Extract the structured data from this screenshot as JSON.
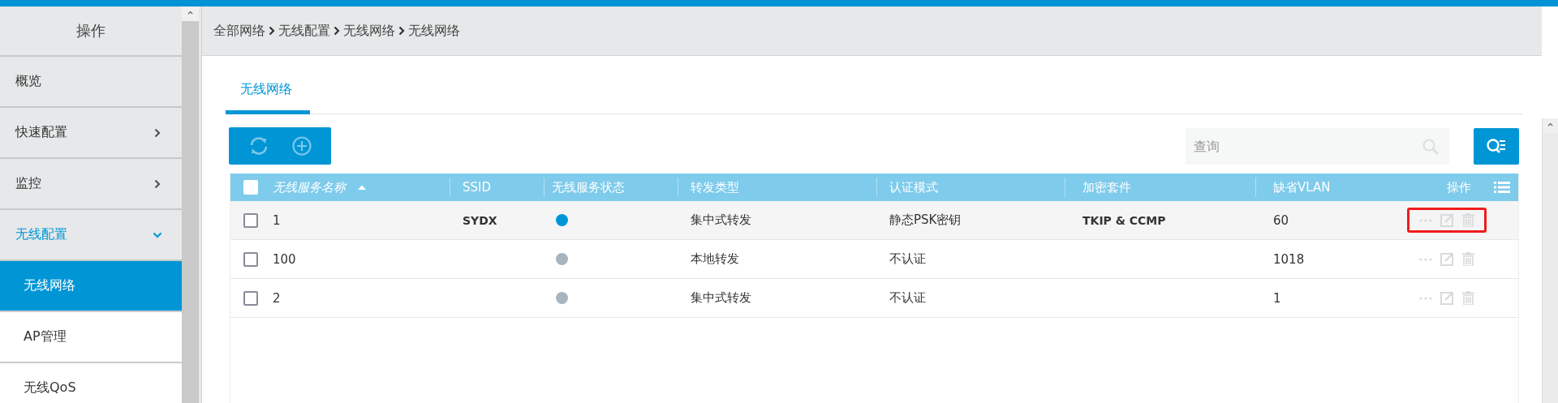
{
  "sidebar": {
    "title": "操作",
    "scroll_up": "⌃",
    "items": [
      {
        "label": "概览",
        "kind": "item",
        "expanded": false,
        "selected": false
      },
      {
        "label": "快速配置",
        "kind": "group",
        "expanded": false,
        "selected": false
      },
      {
        "label": "监控",
        "kind": "group",
        "expanded": false,
        "selected": false
      },
      {
        "label": "无线配置",
        "kind": "group",
        "expanded": true,
        "selected": false
      },
      {
        "label": "无线网络",
        "kind": "sub",
        "expanded": false,
        "selected": true
      },
      {
        "label": "AP管理",
        "kind": "sub",
        "expanded": false,
        "selected": false
      },
      {
        "label": "无线QoS",
        "kind": "sub",
        "expanded": false,
        "selected": false
      }
    ]
  },
  "breadcrumb": [
    "全部网络",
    "无线配置",
    "无线网络",
    "无线网络"
  ],
  "tabs": [
    {
      "label": "无线网络",
      "selected": true
    }
  ],
  "search": {
    "placeholder": "查询"
  },
  "table": {
    "all_checked": false,
    "columns": [
      {
        "label": "无线服务名称",
        "sorted": true
      },
      {
        "label": "SSID",
        "sorted": false
      },
      {
        "label": "无线服务状态",
        "sorted": false
      },
      {
        "label": "转发类型",
        "sorted": false
      },
      {
        "label": "认证模式",
        "sorted": false
      },
      {
        "label": "加密套件",
        "sorted": false
      },
      {
        "label": "缺省VLAN",
        "sorted": false
      },
      {
        "label": "操作",
        "sorted": false
      }
    ],
    "rows": [
      {
        "checked": false,
        "name": "1",
        "ssid": "SYDX",
        "active": true,
        "forwarding": "集中式转发",
        "auth": "静态PSK密钥",
        "cipher": "TKIP & CCMP",
        "vlan": "60",
        "hover": true,
        "highlighted": true
      },
      {
        "checked": false,
        "name": "100",
        "active": false,
        "forwarding": "本地转发",
        "auth": "不认证",
        "vlan": "1018",
        "hover": false,
        "highlighted": false
      },
      {
        "checked": false,
        "name": "2",
        "active": false,
        "forwarding": "集中式转发",
        "auth": "不认证",
        "vlan": "1",
        "hover": false,
        "highlighted": false
      }
    ]
  }
}
